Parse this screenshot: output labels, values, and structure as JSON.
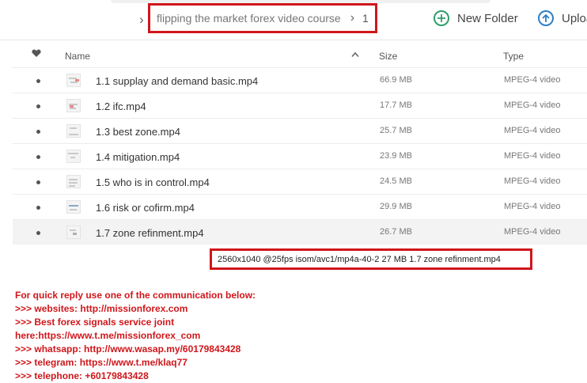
{
  "breadcrumb": {
    "folder": "flipping the market forex video course",
    "subfolder": "1"
  },
  "toolbar": {
    "new_folder_label": "New Folder",
    "upload_label": "Uploa"
  },
  "table": {
    "columns": {
      "favorite": "♥",
      "name": "Name",
      "size": "Size",
      "type": "Type"
    },
    "rows": [
      {
        "name": "1.1 supplay and demand basic.mp4",
        "size": "66.9 MB",
        "type": "MPEG-4 video"
      },
      {
        "name": "1.2 ifc.mp4",
        "size": "17.7 MB",
        "type": "MPEG-4 video"
      },
      {
        "name": "1.3 best zone.mp4",
        "size": "25.7 MB",
        "type": "MPEG-4 video"
      },
      {
        "name": "1.4 mitigation.mp4",
        "size": "23.9 MB",
        "type": "MPEG-4 video"
      },
      {
        "name": "1.5 who is in control.mp4",
        "size": "24.5 MB",
        "type": "MPEG-4 video"
      },
      {
        "name": "1.6 risk or cofirm.mp4",
        "size": "29.9 MB",
        "type": "MPEG-4 video"
      },
      {
        "name": "1.7 zone refinment.mp4",
        "size": "26.7 MB",
        "type": "MPEG-4 video"
      }
    ],
    "selected_index": 6
  },
  "status": {
    "text": "2560x1040 @25fps isom/avc1/mp4a-40-2 27 MB 1.7 zone refinment.mp4"
  },
  "promo": {
    "lines": [
      "For quick reply use one of the communication below:",
      ">>> websites: http://missionforex.com",
      ">>> Best forex signals service joint",
      "here:https://www.t.me/missionforex_com",
      ">>> whatsapp: http://www.wasap.my/60179843428",
      ">>> telegram: https://www.t.me/klaq77",
      ">>> telephone: +60179843428"
    ]
  },
  "colors": {
    "highlight_red": "#d0161b",
    "new_folder_green": "#2e9e6b",
    "upload_blue": "#2b80c8"
  },
  "icons": {
    "new_folder": "plus-circle-icon",
    "upload": "arrow-up-circle-icon",
    "sort": "chevron-up-icon",
    "favorite": "heart-icon"
  }
}
